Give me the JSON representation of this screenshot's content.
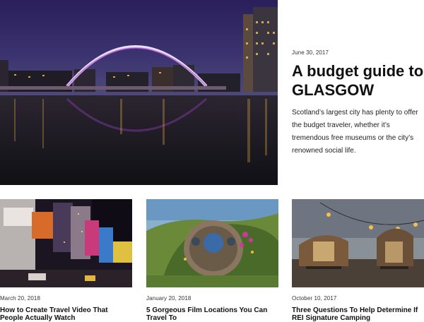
{
  "featured": {
    "date": "June 30, 2017",
    "title": "A budget guide to GLASGOW",
    "excerpt": "Scotland’s largest city has plenty to offer the budget traveler, whether it’s tremendous free museums or the city’s renowned social life."
  },
  "posts": [
    {
      "date": "March 20, 2018",
      "title": "How to Create Travel Video That People Actually Watch"
    },
    {
      "date": "January 20, 2018",
      "title": "5 Gorgeous Film Locations You Can Travel To"
    },
    {
      "date": "October 10, 2017",
      "title": "Three Questions To Help Determine If REI Signature Camping"
    }
  ]
}
